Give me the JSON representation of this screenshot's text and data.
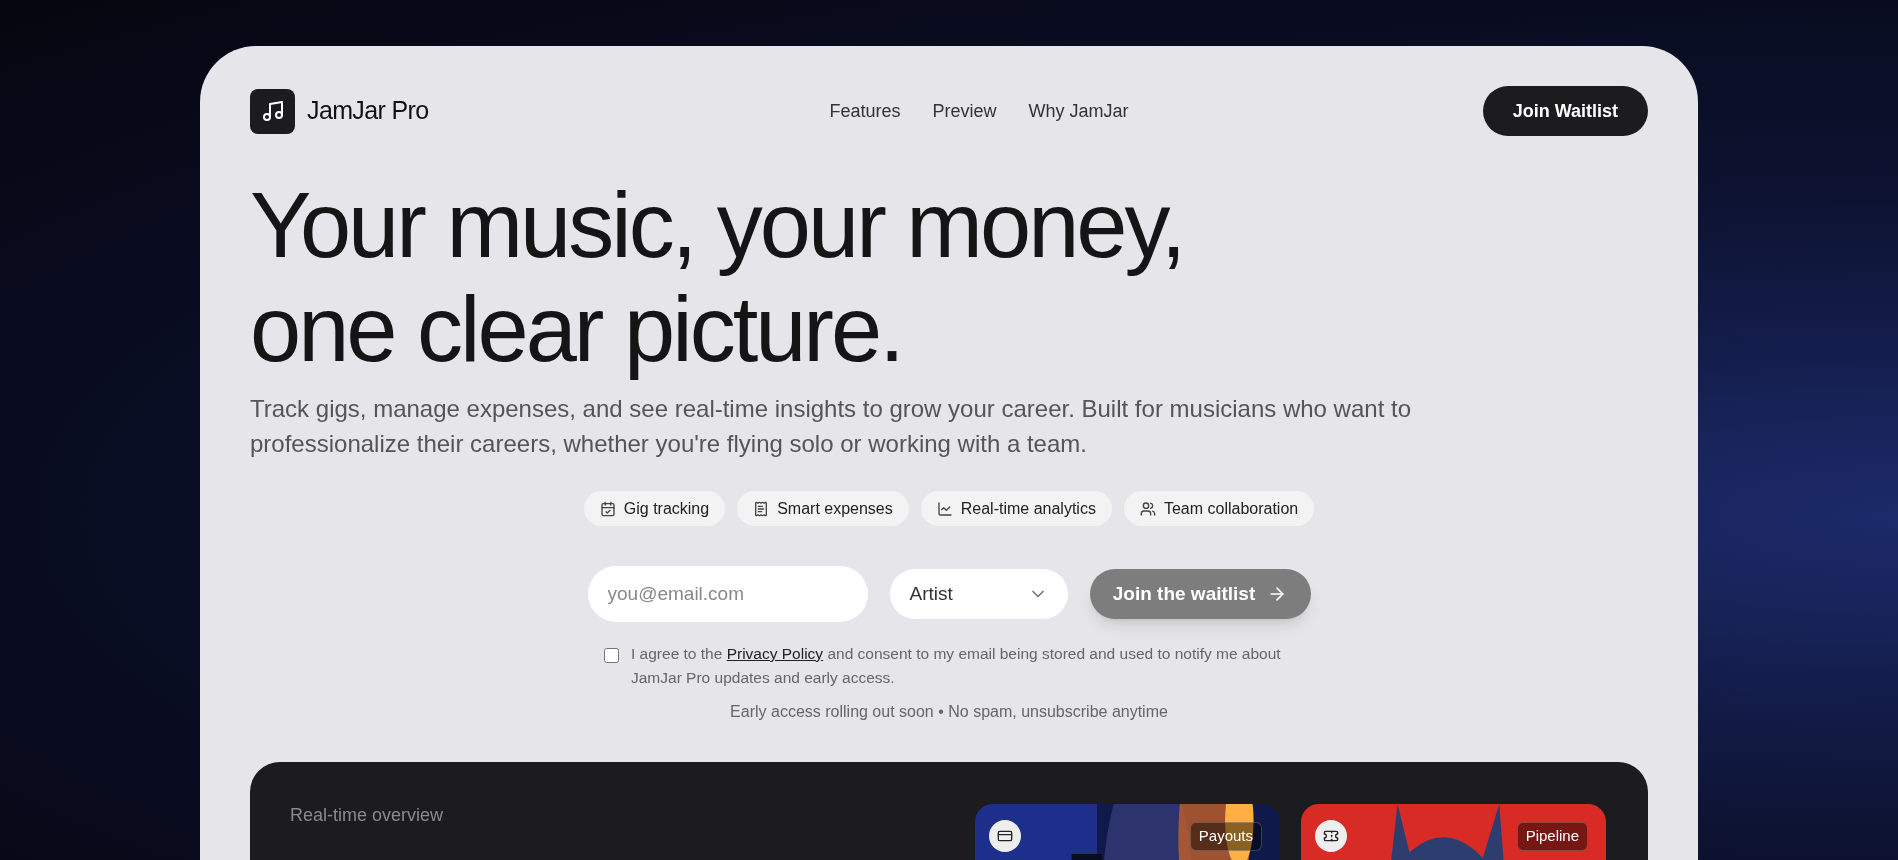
{
  "brand": {
    "name": "JamJar Pro"
  },
  "nav": [
    {
      "label": "Features"
    },
    {
      "label": "Preview"
    },
    {
      "label": "Why JamJar"
    }
  ],
  "header_button": "Join Waitlist",
  "headline": [
    "Your music, your money,",
    "one clear picture."
  ],
  "intro": "Track gigs, manage expenses, and see real-time insights to grow your career. Built for musicians who want to professionalize their careers, whether you're flying solo or working with a team.",
  "features": [
    {
      "kind": "calendar",
      "label": "Gig tracking"
    },
    {
      "kind": "receipt",
      "label": "Smart expenses"
    },
    {
      "kind": "chart",
      "label": "Real-time analytics"
    },
    {
      "kind": "users",
      "label": "Team collaboration"
    }
  ],
  "form": {
    "email": {
      "placeholder": "you@email.com"
    },
    "role": {
      "value": "Artist"
    },
    "submit": "Join the waitlist",
    "consent": {
      "checked": false,
      "before": "I agree to the",
      "link": "Privacy Policy",
      "after": "and consent to my email being stored and used to notify me about JamJar Pro updates and early access."
    },
    "note": "Early access rolling out soon • No spam, unsubscribe anytime"
  },
  "overview": {
    "eyebrow": "Real-time overview",
    "cards": [
      {
        "kind": "concert",
        "tag": "Payouts"
      },
      {
        "kind": "mascot",
        "tag": "Pipeline"
      }
    ]
  }
}
